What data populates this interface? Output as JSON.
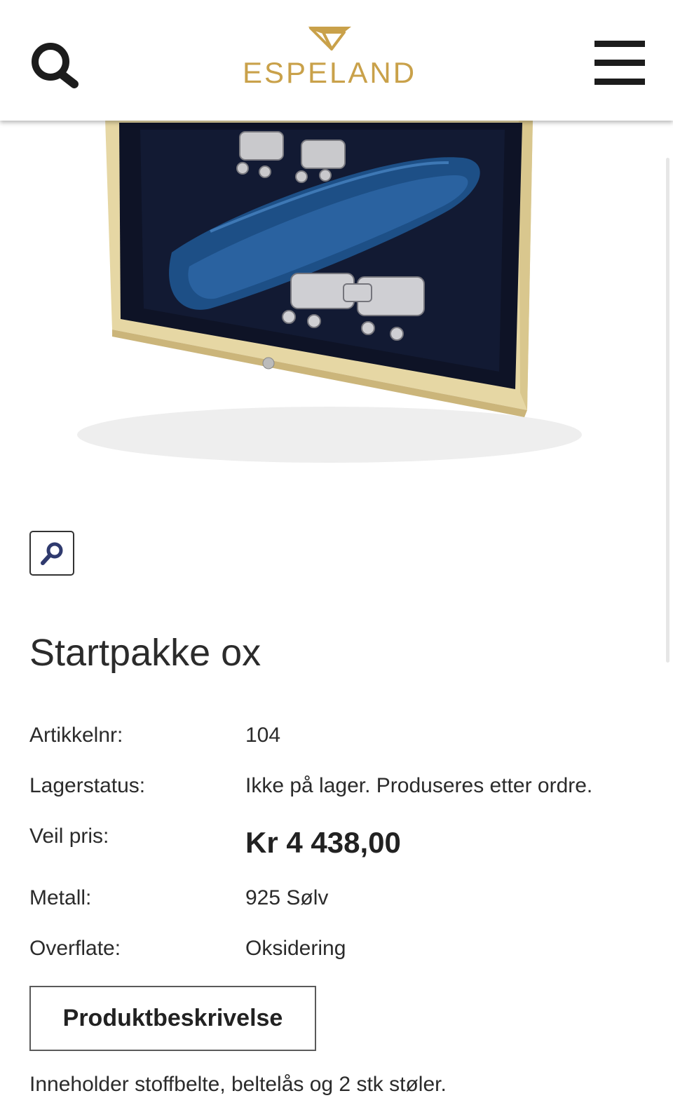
{
  "header": {
    "logo_text": "ESPELAND",
    "search_icon": "search-icon",
    "menu_icon": "hamburger-menu-icon"
  },
  "image": {
    "alt": "Startpakke ox",
    "zoom_icon": "magnifier-icon"
  },
  "product": {
    "title": "Startpakke ox",
    "specs": [
      {
        "label": "Artikkelnr:",
        "value": "104"
      },
      {
        "label": "Lagerstatus:",
        "value": "Ikke på lager. Produseres etter ordre."
      },
      {
        "label": "Veil pris:",
        "value": "Kr 4 438,00"
      },
      {
        "label": "Metall:",
        "value": "925 Sølv"
      },
      {
        "label": "Overflate:",
        "value": "Oksidering"
      }
    ],
    "description_button": "Produktbeskrivelse",
    "description_text": "Inneholder stoffbelte, beltelås og 2 stk støler."
  },
  "colors": {
    "brand_gold": "#c9a14a",
    "text": "#2b2b2b",
    "belt_blue": "#1d4f86"
  }
}
